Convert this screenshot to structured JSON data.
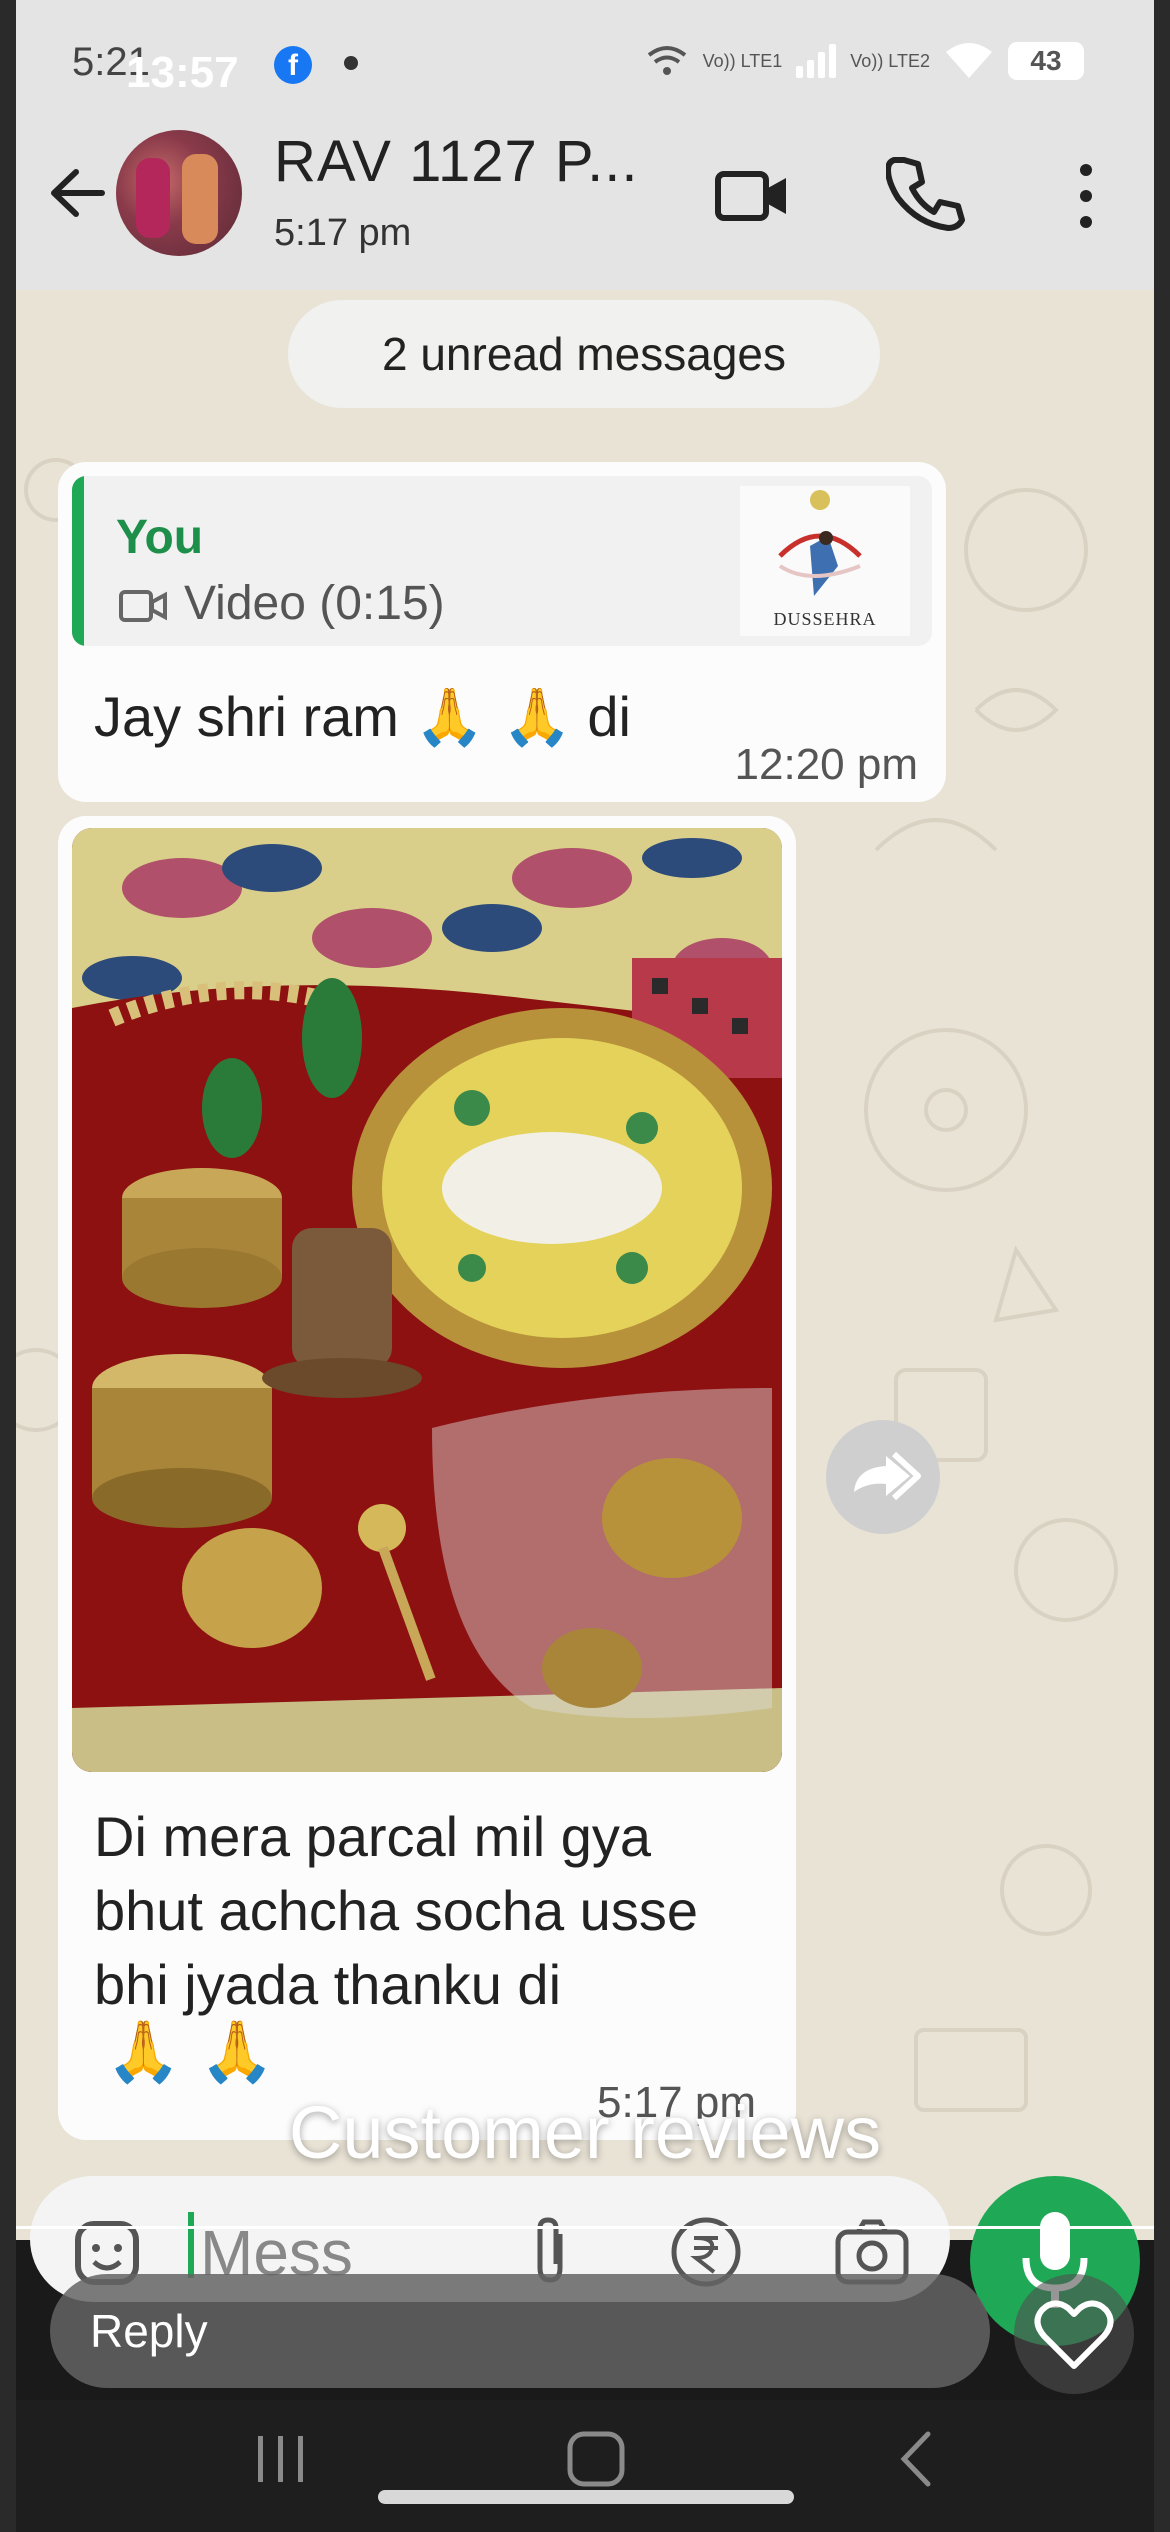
{
  "status_bar": {
    "time_overlay": "13:57",
    "time_underlay": "5:21",
    "battery": "43",
    "network_labels": [
      "Vo)) LTE1",
      "Vo)) LTE2"
    ]
  },
  "header": {
    "contact_name": "RAV 1127 P...",
    "last_seen": "5:17 pm"
  },
  "chat": {
    "unread_label": "2 unread messages",
    "messages": [
      {
        "quote_author": "You",
        "quote_media": "Video (0:15)",
        "quote_thumb_text": "DUSSEHRA",
        "text": "Jay shri ram",
        "text_suffix": "di",
        "emojis": "🙏 🙏",
        "time": "12:20 pm"
      },
      {
        "text": "Di mera parcal mil gya bhut achcha socha usse bhi jyada thanku di",
        "emojis": "🙏 🙏",
        "time": "5:17 pm"
      }
    ]
  },
  "overlay": {
    "caption": "Customer reviews",
    "reply_label": "Reply"
  },
  "input": {
    "placeholder": "Mess"
  },
  "colors": {
    "accent_green": "#1fa855",
    "header_bg": "#e4e4e4",
    "wallpaper": "#e9e3d6"
  },
  "icons": [
    "back-arrow-icon",
    "video-call-icon",
    "phone-icon",
    "more-vert-icon",
    "forward-icon",
    "emoji-icon",
    "attach-icon",
    "rupee-icon",
    "camera-icon",
    "mic-icon",
    "heart-icon"
  ]
}
